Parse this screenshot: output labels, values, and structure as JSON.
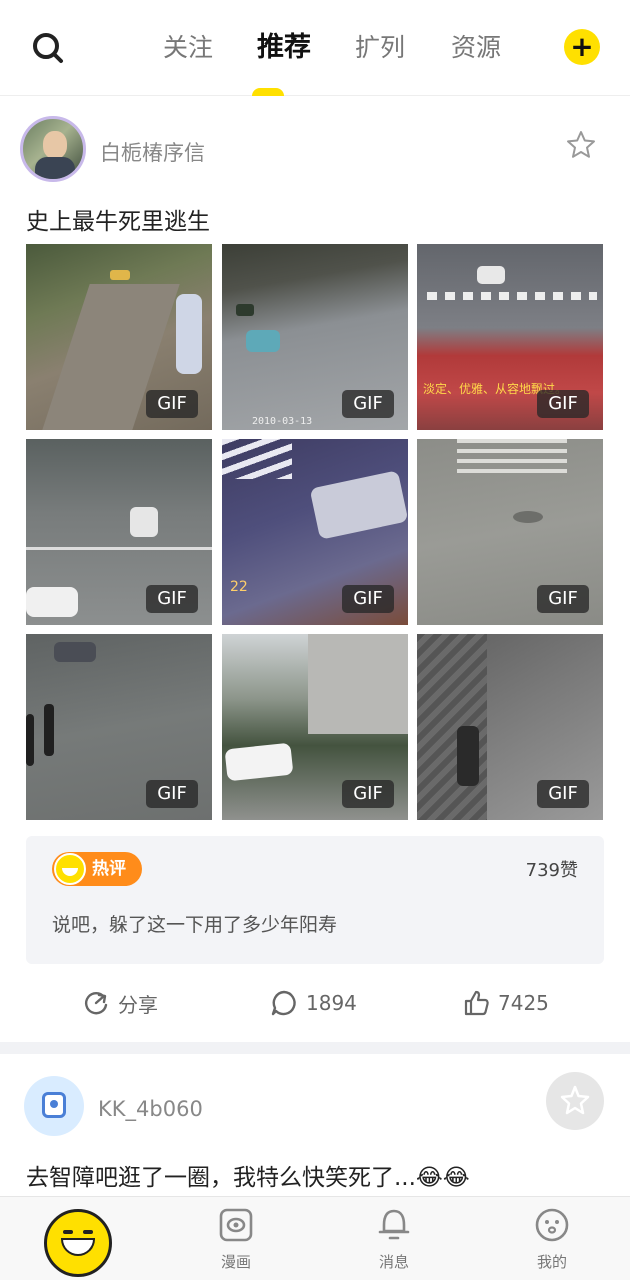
{
  "topbar": {
    "tabs": [
      {
        "label": "关注",
        "active": false
      },
      {
        "label": "推荐",
        "active": true
      },
      {
        "label": "扩列",
        "active": false
      },
      {
        "label": "资源",
        "active": false
      }
    ],
    "accent_color": "#ffe000"
  },
  "posts": [
    {
      "username": "白栀椿序信",
      "title": "史上最牛死里逃生",
      "media": [
        {
          "type": "GIF",
          "caption": ""
        },
        {
          "type": "GIF",
          "caption": "2010-03-13"
        },
        {
          "type": "GIF",
          "caption": "淡定、优雅、从容地飘过。"
        },
        {
          "type": "GIF",
          "caption": ""
        },
        {
          "type": "GIF",
          "caption": "22"
        },
        {
          "type": "GIF",
          "caption": ""
        },
        {
          "type": "GIF",
          "caption": ""
        },
        {
          "type": "GIF",
          "caption": ""
        },
        {
          "type": "GIF",
          "caption": ""
        }
      ],
      "hot_comment": {
        "badge": "热评",
        "likes": "739赞",
        "text": "说吧，躲了这一下用了多少年阳寿"
      },
      "actions": {
        "share": "分享",
        "comments": "1894",
        "likes": "7425"
      }
    },
    {
      "username": "KK_4b060",
      "title": "去智障吧逛了一圈，我特么快笑死了...😂😂"
    }
  ],
  "bottom_nav": {
    "items": [
      {
        "label": "漫画",
        "icon": "comic-icon"
      },
      {
        "label": "消息",
        "icon": "bell-icon"
      },
      {
        "label": "我的",
        "icon": "profile-face-icon"
      }
    ]
  }
}
